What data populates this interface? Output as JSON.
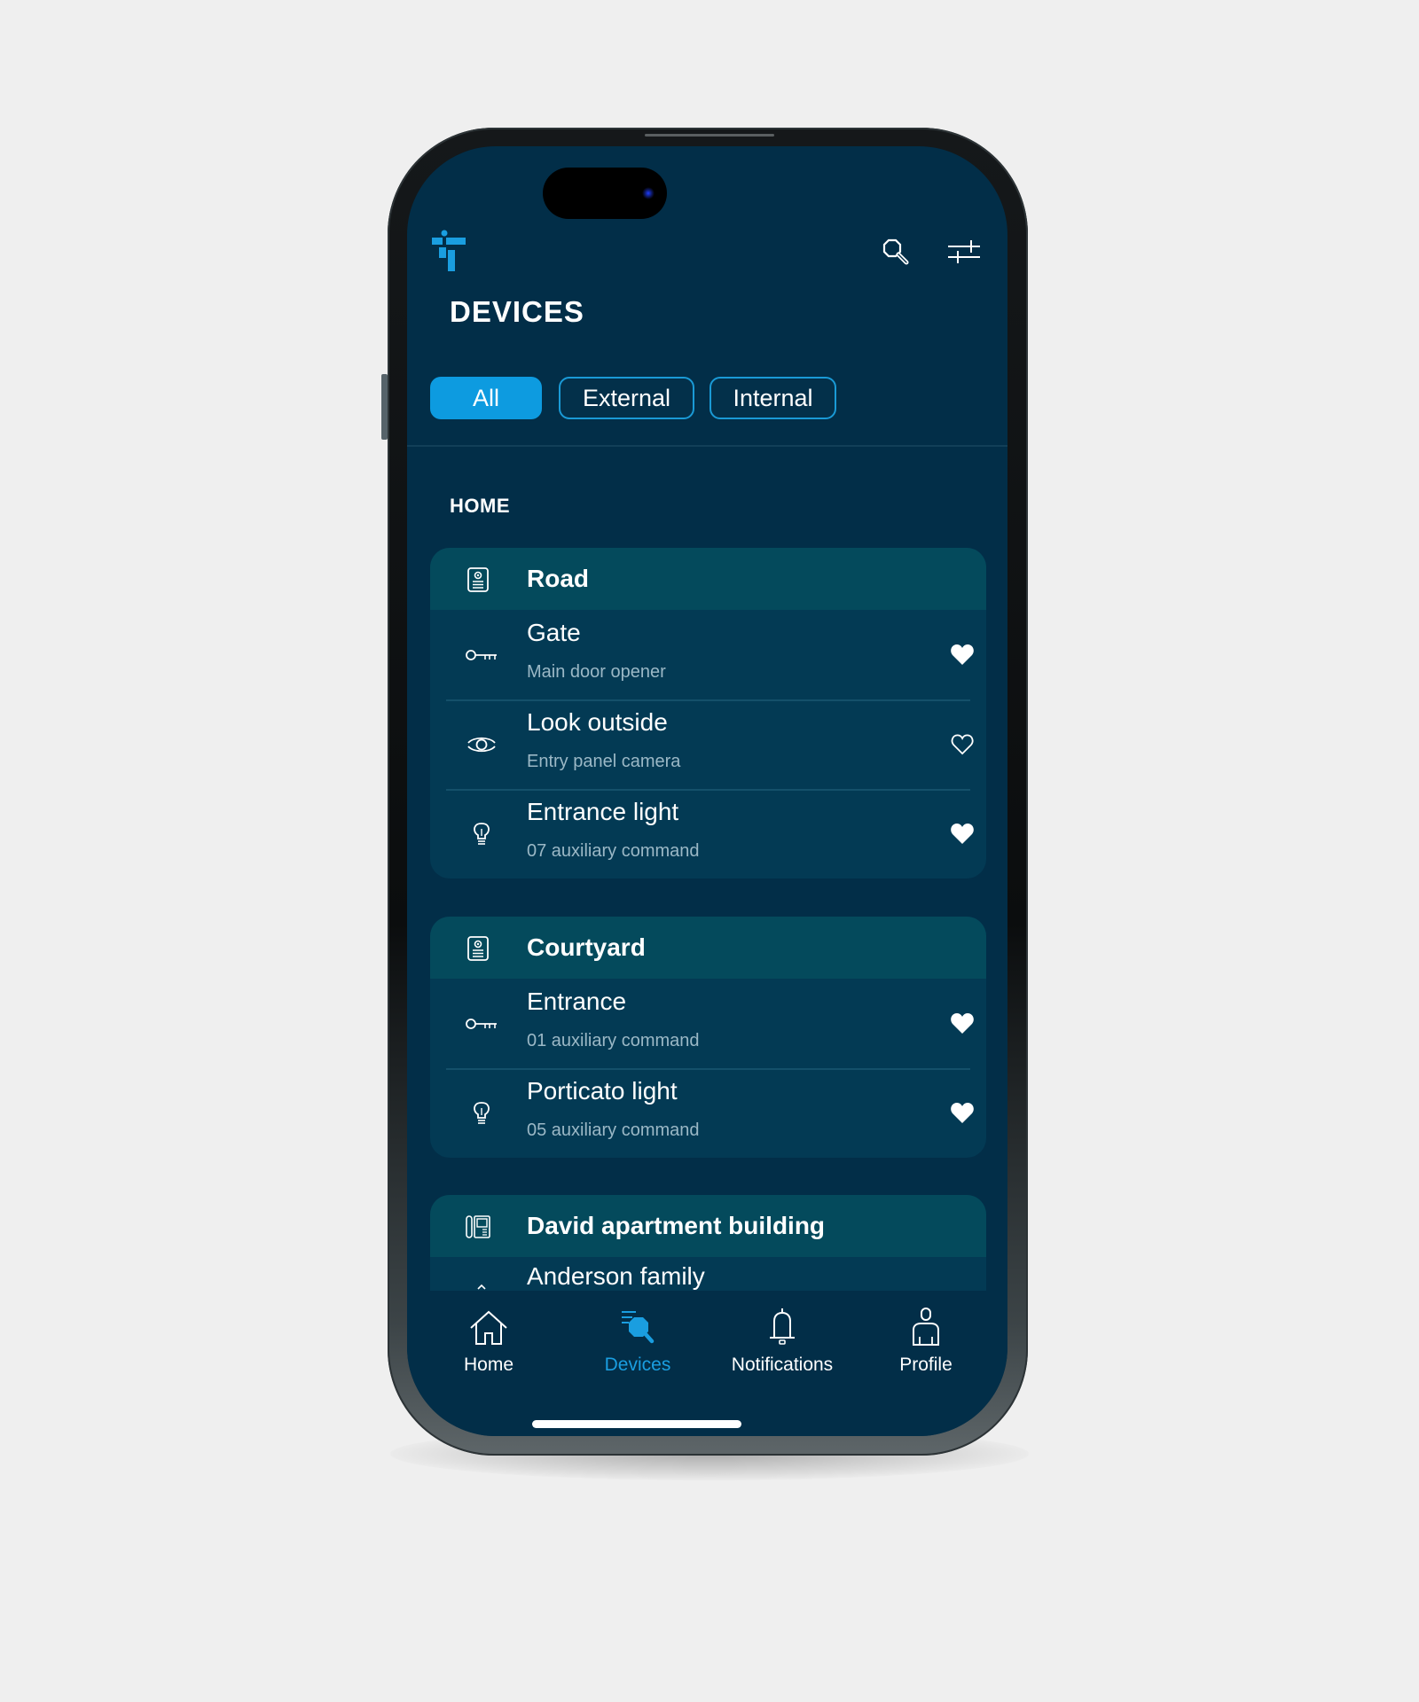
{
  "header": {
    "logo": "brand-logo",
    "title": "DEVICES",
    "icons": [
      "search-icon",
      "filter-sliders-icon"
    ]
  },
  "filters": [
    {
      "label": "All",
      "active": true
    },
    {
      "label": "External",
      "active": false
    },
    {
      "label": "Internal",
      "active": false
    }
  ],
  "section": {
    "label": "HOME"
  },
  "groups": [
    {
      "name": "Road",
      "icon": "entry-panel-icon",
      "devices": [
        {
          "title": "Gate",
          "subtitle": "Main door opener",
          "icon": "key-icon",
          "favorite": true
        },
        {
          "title": "Look outside",
          "subtitle": "Entry panel camera",
          "icon": "eye-icon",
          "favorite": false
        },
        {
          "title": "Entrance light",
          "subtitle": "07 auxiliary command",
          "icon": "lightbulb-icon",
          "favorite": true
        }
      ]
    },
    {
      "name": "Courtyard",
      "icon": "entry-panel-icon",
      "devices": [
        {
          "title": "Entrance",
          "subtitle": "01 auxiliary command",
          "icon": "key-icon",
          "favorite": true
        },
        {
          "title": "Porticato light",
          "subtitle": "05 auxiliary command",
          "icon": "lightbulb-icon",
          "favorite": true
        }
      ]
    },
    {
      "name": "David apartment building",
      "icon": "intercom-panel-icon",
      "devices": [
        {
          "title": "Anderson family",
          "subtitle": "",
          "icon": "chevron-icon",
          "favorite": null
        }
      ]
    }
  ],
  "nav": [
    {
      "label": "Home",
      "icon": "home-icon",
      "active": false
    },
    {
      "label": "Devices",
      "icon": "devices-search-icon",
      "active": true
    },
    {
      "label": "Notifications",
      "icon": "bell-icon",
      "active": false
    },
    {
      "label": "Profile",
      "icon": "user-icon",
      "active": false
    }
  ],
  "colors": {
    "background": "#022e48",
    "card": "#033a54",
    "card_header": "#044a5c",
    "accent": "#0d9be0",
    "subtitle": "#9bb8c6"
  }
}
